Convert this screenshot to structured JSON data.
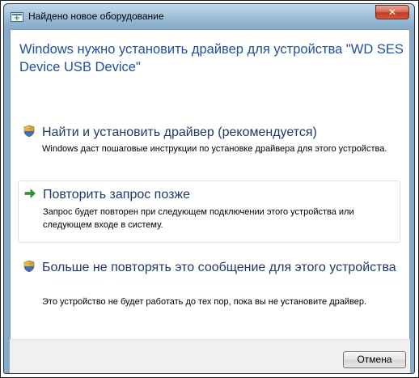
{
  "window": {
    "title": "Найдено новое оборудование",
    "close_label": "✕"
  },
  "heading": "Windows нужно установить драйвер для устройства \"WD SES Device USB Device\"",
  "options": [
    {
      "title": "Найти и установить драйвер (рекомендуется)",
      "description": "Windows даст пошаговые инструкции по установке драйвера для этого устройства.",
      "icon": "shield-icon"
    },
    {
      "title": "Повторить запрос позже",
      "description": "Запрос будет повторен при следующем подключении этого устройства или следующем входе в систему.",
      "icon": "arrow-right-icon"
    },
    {
      "title": "Больше не повторять это сообщение для этого устройства",
      "description": "Это устройство не будет работать до тех пор, пока вы не установите драйвер.",
      "icon": "shield-icon"
    }
  ],
  "footer": {
    "cancel_label": "Отмена"
  },
  "colors": {
    "heading": "#1f4ea0",
    "option_title": "#1e3a6a",
    "arrow": "#2e9a2e",
    "close_button": "#c13c23"
  }
}
